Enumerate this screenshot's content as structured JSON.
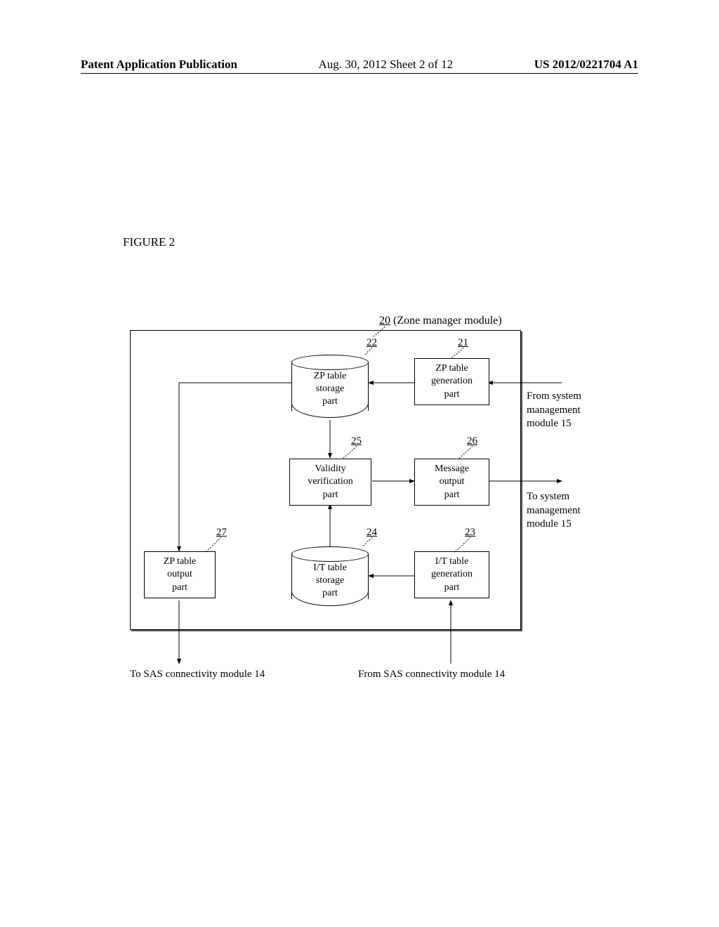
{
  "header": {
    "left": "Patent Application Publication",
    "center": "Aug. 30, 2012  Sheet 2 of 12",
    "right": "US 2012/0221704 A1"
  },
  "figure_label": "FIGURE 2",
  "module": {
    "ref": "20",
    "name": "(Zone manager module)"
  },
  "blocks": {
    "b21": {
      "ref": "21",
      "l1": "ZP table",
      "l2": "generation",
      "l3": "part"
    },
    "b22": {
      "ref": "22",
      "l1": "ZP table",
      "l2": "storage",
      "l3": "part"
    },
    "b23": {
      "ref": "23",
      "l1": "I/T table",
      "l2": "generation",
      "l3": "part"
    },
    "b24": {
      "ref": "24",
      "l1": "I/T table",
      "l2": "storage",
      "l3": "part"
    },
    "b25": {
      "ref": "25",
      "l1": "Validity",
      "l2": "verification",
      "l3": "part"
    },
    "b26": {
      "ref": "26",
      "l1": "Message",
      "l2": "output",
      "l3": "part"
    },
    "b27": {
      "ref": "27",
      "l1": "ZP table",
      "l2": "output",
      "l3": "part"
    }
  },
  "ext": {
    "from_sys": {
      "l1": "From system",
      "l2": "management",
      "l3": "module 15"
    },
    "to_sys": {
      "l1": "To system",
      "l2": "management",
      "l3": "module 15"
    },
    "to_sas": "To SAS connectivity module 14",
    "from_sas": "From SAS connectivity module 14"
  }
}
